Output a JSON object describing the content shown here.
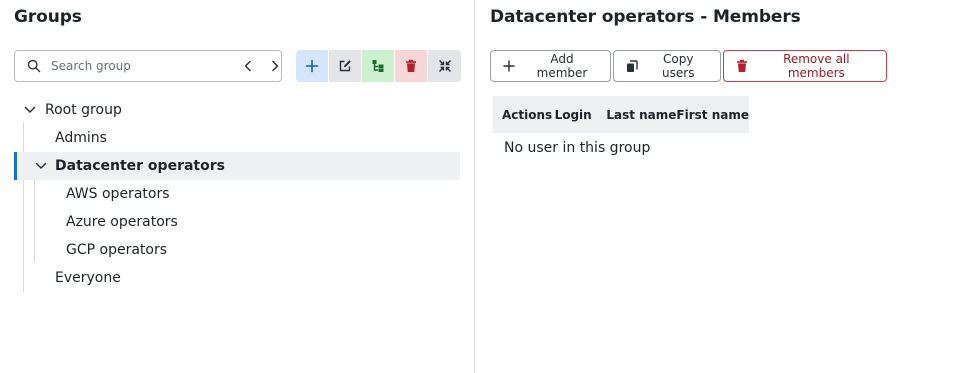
{
  "left": {
    "title": "Groups",
    "search": {
      "placeholder": "Search group",
      "value": ""
    },
    "toolbar": [
      "add-icon",
      "edit-icon",
      "move-icon",
      "trash-icon",
      "collapse-icon"
    ],
    "tree": {
      "root": "Root group",
      "admins": "Admins",
      "datacenter": "Datacenter operators",
      "aws": "AWS operators",
      "azure": "Azure operators",
      "gcp": "GCP operators",
      "everyone": "Everyone"
    }
  },
  "right": {
    "title": "Datacenter operators - Members",
    "buttons": {
      "add": "Add member",
      "copy": "Copy users",
      "remove": "Remove all members"
    },
    "table": {
      "columns": [
        "Actions",
        "Login",
        "Last name",
        "First name"
      ],
      "empty": "No user in this group"
    }
  },
  "colors": {
    "accent": "#1a6fd6",
    "danger": "#c8434f",
    "add_bg": "#d3e6fb",
    "move_bg": "#cdf0cf",
    "delete_bg": "#f7d6d8"
  }
}
